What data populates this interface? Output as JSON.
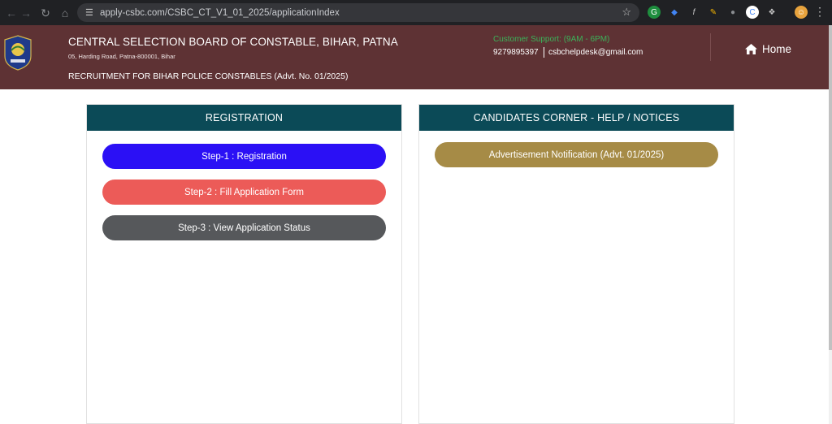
{
  "browser": {
    "url": "apply-csbc.com/CSBC_CT_V1_01_2025/applicationIndex"
  },
  "header": {
    "org_title": "CENTRAL SELECTION BOARD OF CONSTABLE, BIHAR, PATNA",
    "address": "05, Harding Road, Patna-800001, Bihar",
    "recruitment": "RECRUITMENT FOR BIHAR POLICE CONSTABLES (Advt. No. 01/2025)",
    "support_title": "Customer Support: (9AM - 6PM)",
    "support_phone": "9279895397",
    "support_email": "csbchelpdesk@gmail.com",
    "home_label": "Home"
  },
  "registration": {
    "title": "REGISTRATION",
    "steps": [
      {
        "label": "Step-1 : Registration",
        "color": "#2b10f5"
      },
      {
        "label": "Step-2 : Fill Application Form",
        "color": "#ec5b58"
      },
      {
        "label": "Step-3 : View Application Status",
        "color": "#56585b"
      }
    ]
  },
  "candidates_corner": {
    "title": "CANDIDATES CORNER - HELP / NOTICES",
    "notices": [
      {
        "label": "Advertisement Notification (Advt. 01/2025)",
        "color": "#a68b46"
      }
    ]
  },
  "colors": {
    "header_bg": "#5e3234",
    "panel_head_bg": "#0b4a57",
    "support_green": "#3bb35a"
  }
}
